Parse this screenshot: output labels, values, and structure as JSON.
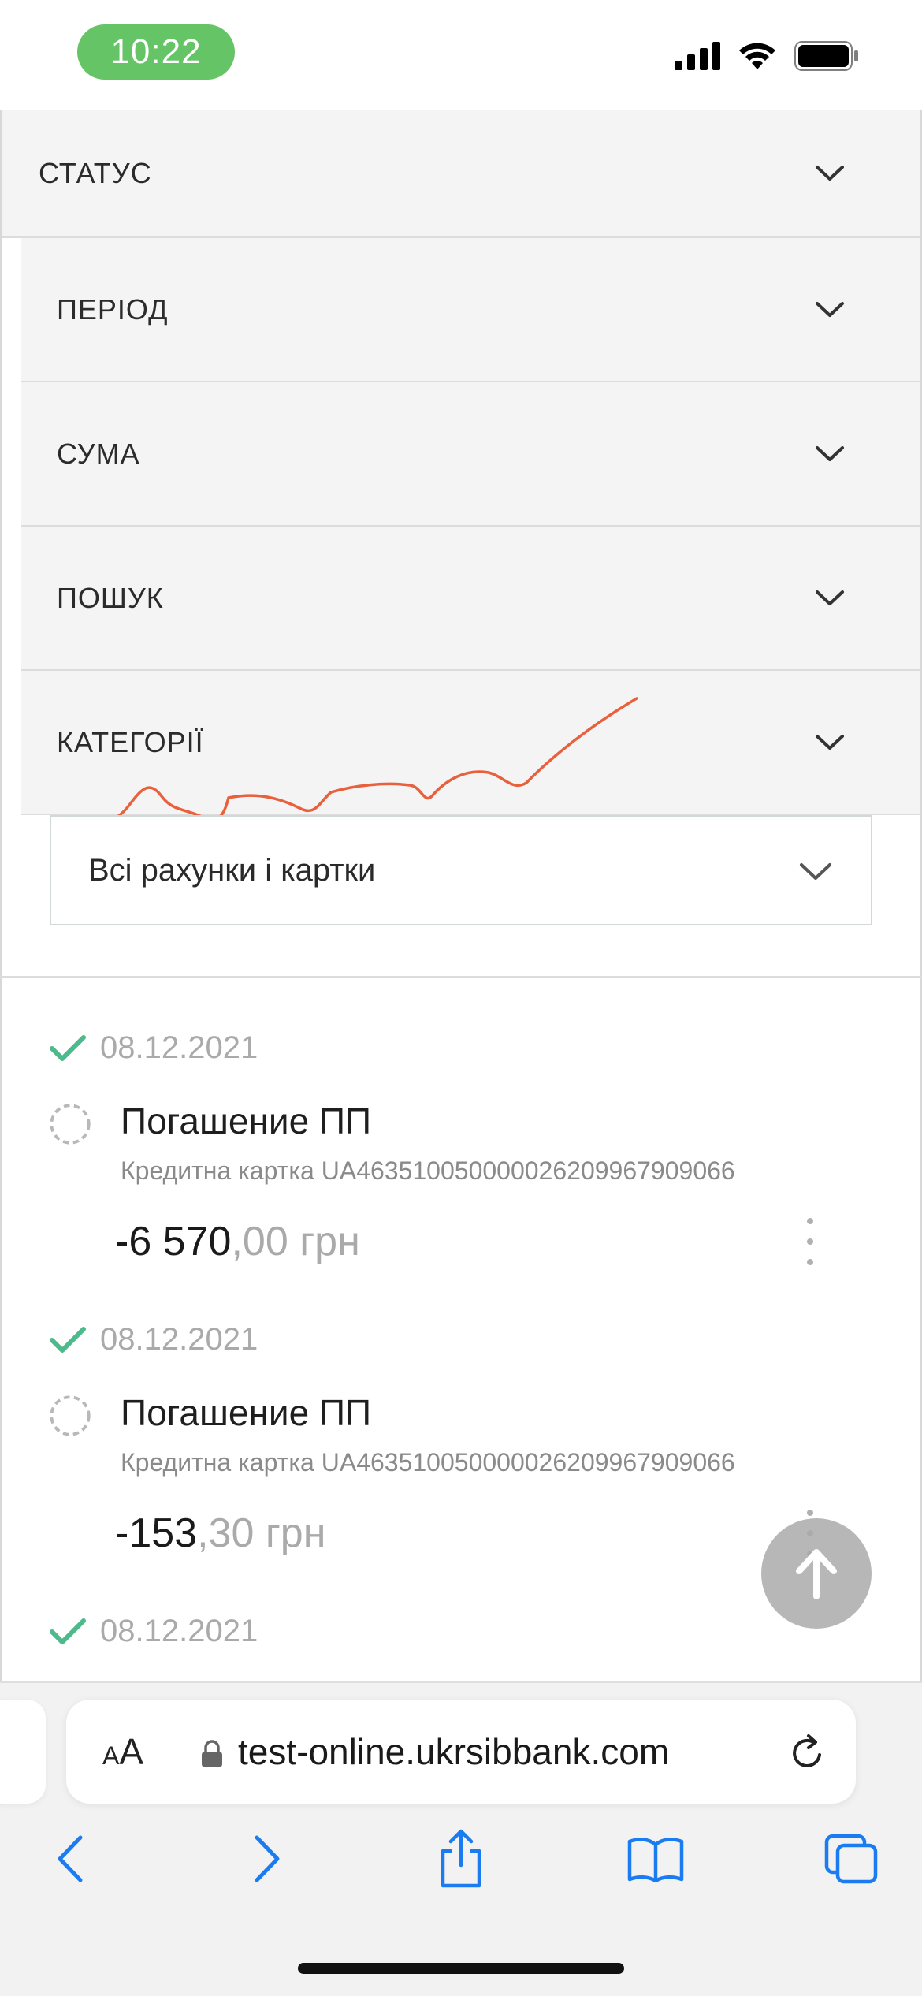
{
  "status_bar": {
    "time": "10:22"
  },
  "filters": [
    {
      "label": "СТАТУС"
    },
    {
      "label": "ПЕРІОД"
    },
    {
      "label": "СУМА"
    },
    {
      "label": "ПОШУК"
    },
    {
      "label": "КАТЕГОРІЇ"
    }
  ],
  "account_select": {
    "value": "Всі рахунки і картки"
  },
  "transactions": [
    {
      "date": "08.12.2021",
      "title": "Погашение ПП",
      "subtitle": "Кредитна картка UA463510050000026209967909066",
      "amount_main": "-6 570",
      "amount_dec": ",00 грн"
    },
    {
      "date": "08.12.2021",
      "title": "Погашение ПП",
      "subtitle": "Кредитна картка UA463510050000026209967909066",
      "amount_main": "-153",
      "amount_dec": ",30 грн"
    },
    {
      "date": "08.12.2021"
    }
  ],
  "browser": {
    "text_size_label_small": "A",
    "text_size_label_large": "A",
    "url": "test-online.ukrsibbank.com"
  },
  "colors": {
    "accent_green": "#4cba8a",
    "time_pill": "#65c466",
    "chart_line": "#e8603c",
    "ios_blue": "#1a7cf0"
  },
  "icons": {
    "check": "check-icon",
    "pending": "pending-circle-icon",
    "chevron": "chevron-down-icon",
    "scroll_top": "arrow-up-icon"
  }
}
